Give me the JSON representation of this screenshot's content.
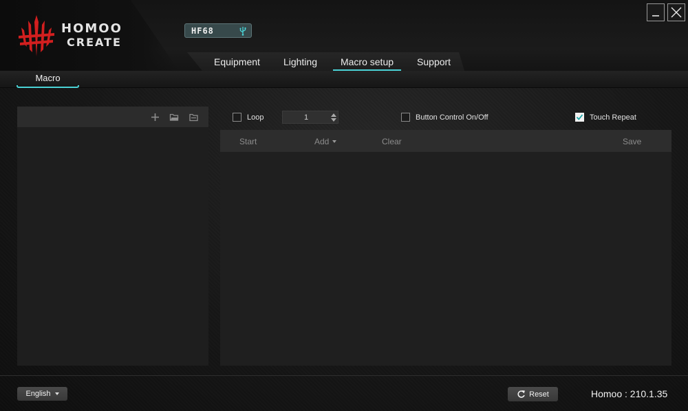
{
  "app": {
    "brand_line1": "HOMOO",
    "brand_line2": "CREATE",
    "device_name": "HF68",
    "version": "Homoo : 210.1.35"
  },
  "window_controls": {
    "minimize_icon": "minimize-icon",
    "close_icon": "close-icon"
  },
  "nav": {
    "tabs": [
      {
        "label": "Equipment"
      },
      {
        "label": "Lighting"
      },
      {
        "label": "Macro setup",
        "active": true
      },
      {
        "label": "Support"
      }
    ]
  },
  "subtab": {
    "label": "Macro"
  },
  "macro_list": {
    "toolbar_icons": [
      "plus-icon",
      "folder-open-icon",
      "folder-icon"
    ]
  },
  "options": {
    "loop_label": "Loop",
    "loop_checked": false,
    "loop_count": "1",
    "button_control_label": "Button Control On/Off",
    "button_control_checked": false,
    "touch_repeat_label": "Touch Repeat",
    "touch_repeat_checked": true
  },
  "editor_toolbar": {
    "start_label": "Start",
    "add_label": "Add",
    "clear_label": "Clear",
    "save_label": "Save"
  },
  "footer": {
    "language": "English",
    "reset_label": "Reset"
  },
  "colors": {
    "accent": "#4ad3d6",
    "logo_red": "#d21f1f"
  }
}
